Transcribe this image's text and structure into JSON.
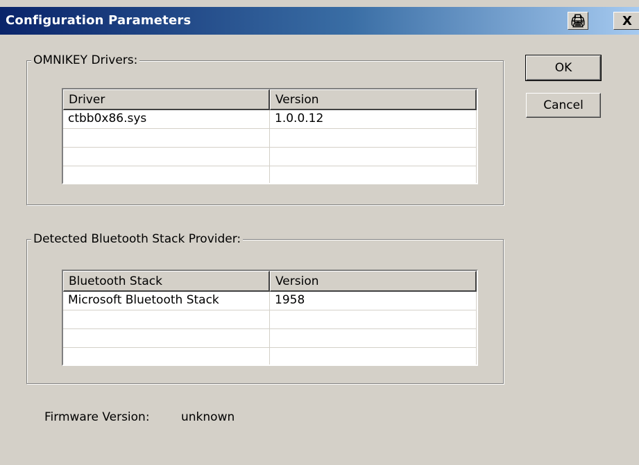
{
  "window": {
    "title": "Configuration Parameters",
    "help_glyph": "🖨",
    "close_glyph": "X"
  },
  "drivers_group": {
    "legend": "OMNIKEY Drivers:",
    "columns": [
      "Driver",
      "Version"
    ],
    "rows": [
      [
        "ctbb0x86.sys",
        "1.0.0.12"
      ],
      [
        "",
        ""
      ],
      [
        "",
        ""
      ],
      [
        "",
        ""
      ]
    ]
  },
  "bluetooth_group": {
    "legend": "Detected Bluetooth Stack Provider:",
    "columns": [
      "Bluetooth Stack",
      "Version"
    ],
    "rows": [
      [
        "Microsoft Bluetooth Stack",
        "1958"
      ],
      [
        "",
        ""
      ],
      [
        "",
        ""
      ],
      [
        "",
        ""
      ]
    ]
  },
  "buttons": {
    "ok": "OK",
    "cancel": "Cancel"
  },
  "firmware": {
    "label": "Firmware Version:",
    "value": "unknown"
  }
}
